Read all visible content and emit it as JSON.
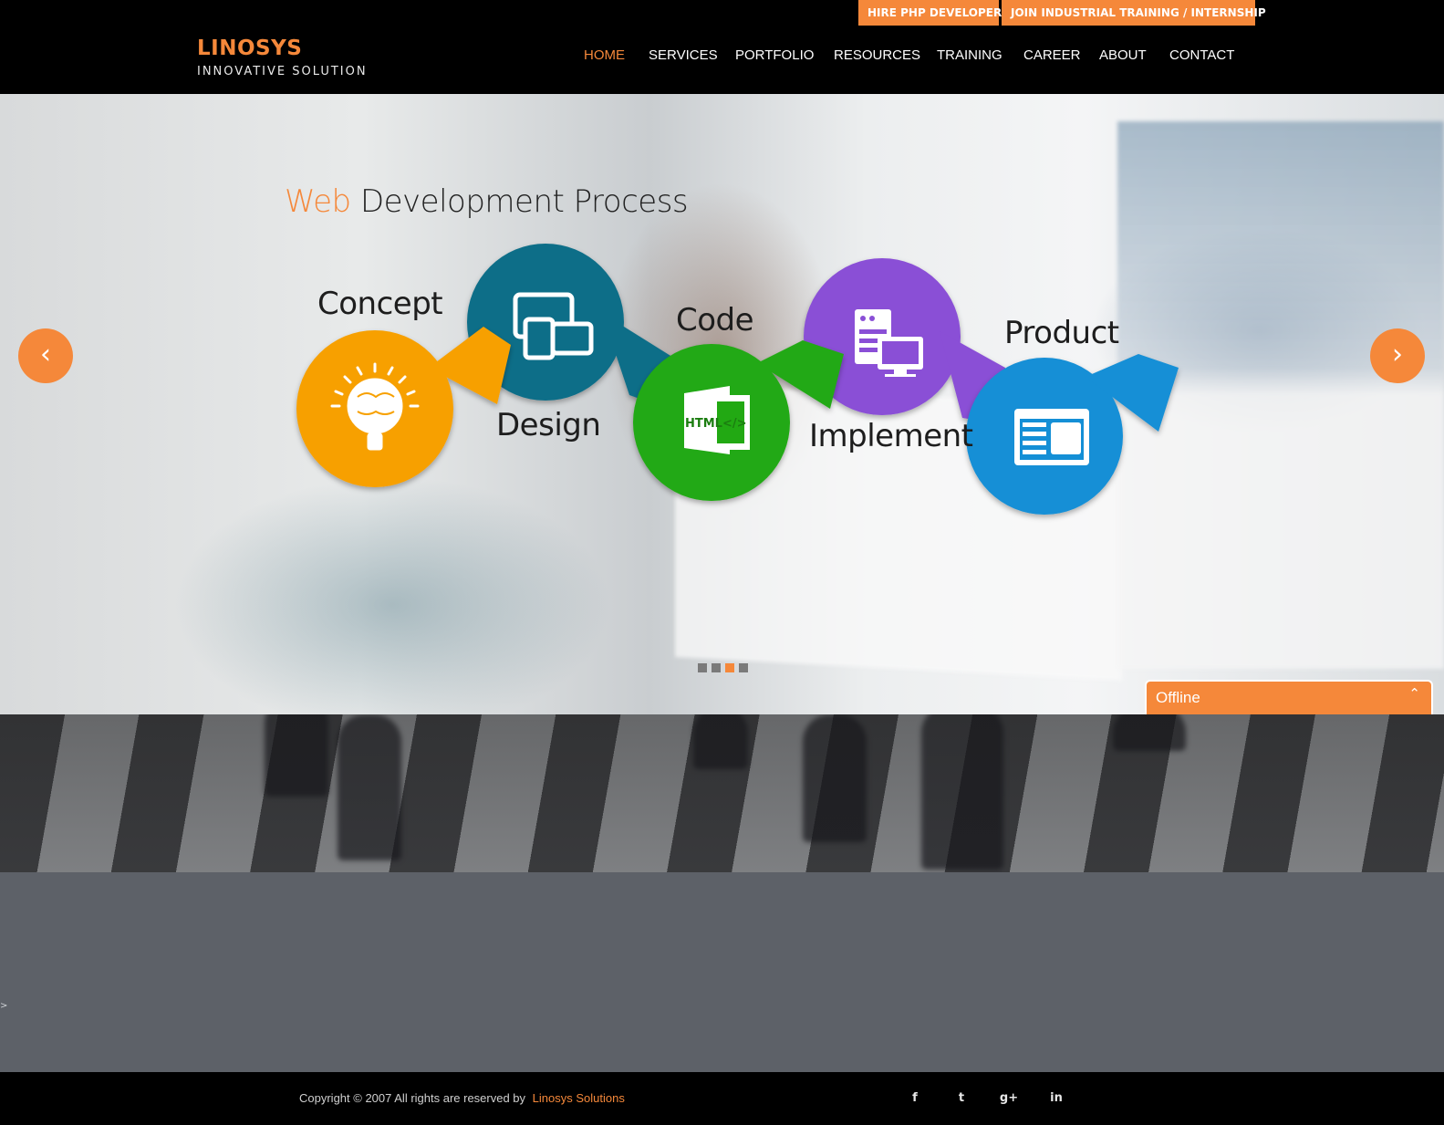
{
  "header": {
    "top_buttons": [
      {
        "label": "HIRE PHP DEVELOPER"
      },
      {
        "label": "JOIN INDUSTRIAL TRAINING / INTERNSHIP"
      }
    ],
    "logo": {
      "title": "LINOSYS",
      "subtitle": "INNOVATIVE SOLUTION"
    },
    "nav": [
      {
        "label": "HOME",
        "active": true
      },
      {
        "label": "SERVICES"
      },
      {
        "label": "PORTFOLIO"
      },
      {
        "label": "RESOURCES"
      },
      {
        "label": "TRAINING"
      },
      {
        "label": "CAREER"
      },
      {
        "label": "ABOUT"
      },
      {
        "label": "CONTACT"
      }
    ]
  },
  "hero": {
    "title_accent": "Web",
    "title_rest": "Development Process",
    "stages": [
      {
        "label": "Concept",
        "color": "#f7a000",
        "icon": "lightbulb-icon"
      },
      {
        "label": "Design",
        "color": "#0d6e88",
        "icon": "devices-icon"
      },
      {
        "label": "Code",
        "color": "#22a913",
        "icon": "html-code-icon",
        "icon_text": "HTML</>"
      },
      {
        "label": "Implement",
        "color": "#8a4fd6",
        "icon": "server-monitor-icon"
      },
      {
        "label": "Product",
        "color": "#148fd6",
        "icon": "browser-window-icon"
      }
    ],
    "prev_icon": "chevron-left-icon",
    "next_icon": "chevron-right-icon",
    "prev_glyph": "‹",
    "next_glyph": "›",
    "slides": 4,
    "active_slide": 3
  },
  "stray_text": ">",
  "chat": {
    "label": "Offline",
    "toggle_icon": "chevron-up-icon",
    "toggle_glyph": "⌃"
  },
  "footer": {
    "copyright": "Copyright © 2007 All rights are reserved by",
    "company": "Linosys Solutions",
    "social": [
      {
        "icon": "facebook-icon",
        "glyph": "f"
      },
      {
        "icon": "twitter-icon",
        "glyph": "t"
      },
      {
        "icon": "google-plus-icon",
        "glyph": "g+"
      },
      {
        "icon": "linkedin-icon",
        "glyph": "in"
      }
    ]
  },
  "colors": {
    "accent": "#f5883a",
    "header_bg": "#000000",
    "body_bg": "#5d6168"
  }
}
